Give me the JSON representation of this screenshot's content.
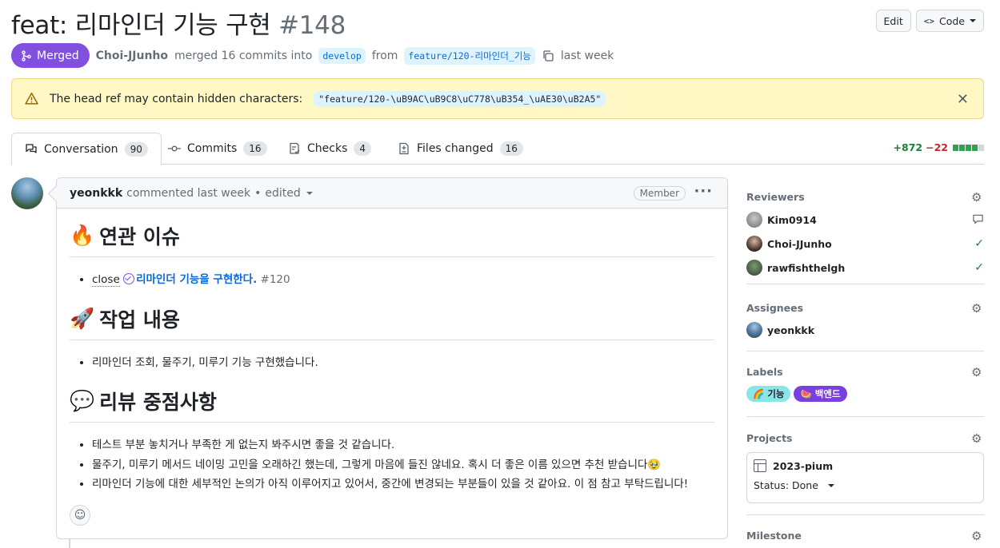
{
  "pr": {
    "title": "feat: 리마인더 기능 구현",
    "number": "#148",
    "edit_label": "Edit",
    "code_label": "Code",
    "state": "Merged",
    "author": "Choi-JJunho",
    "merge_text": "merged 16 commits into",
    "base_branch": "develop",
    "from_text": "from",
    "head_branch": "feature/120-리마인더_기능",
    "time": "last week"
  },
  "warning": {
    "text": "The head ref may contain hidden characters:",
    "code": "\"feature/120-\\uB9AC\\uB9C8\\uC778\\uB354_\\uAE30\\uB2A5\""
  },
  "tabs": [
    {
      "label": "Conversation",
      "count": "90",
      "icon": "comment-discussion-icon"
    },
    {
      "label": "Commits",
      "count": "16",
      "icon": "git-commit-icon"
    },
    {
      "label": "Checks",
      "count": "4",
      "icon": "checklist-icon"
    },
    {
      "label": "Files changed",
      "count": "16",
      "icon": "file-diff-icon"
    }
  ],
  "diffstat": {
    "additions": "+872",
    "deletions": "−22",
    "add_blocks": 4,
    "total_blocks": 5
  },
  "comment": {
    "author": "yeonkkk",
    "action": "commented last week",
    "separator": "•",
    "edited": "edited",
    "role": "Member",
    "h1_emoji": "🔥",
    "h1": "연관 이슈",
    "issue_prefix": "close",
    "issue_title": "리마인더 기능을 구현한다.",
    "issue_number": "#120",
    "h2_emoji": "🚀",
    "h2": "작업 내용",
    "work_items": [
      "리마인더 조회, 물주기, 미루기 기능 구현했습니다."
    ],
    "h3_emoji": "💬",
    "h3": "리뷰 중점사항",
    "review_items": [
      "테스트 부분 놓치거나 부족한 게 없는지 봐주시면 좋을 것 같습니다.",
      "물주기, 미루기 메서드 네이밍 고민을 오래하긴 했는데, 그렇게 마음에 들진 않네요. 혹시 더 좋은 이름 있으면 추천 받습니다🥹",
      "리마인더 기능에 대한 세부적인 논의가 아직 이루어지고 있어서, 중간에 변경되는 부분들이 있을 것 같아요. 이 점 참고 부탁드립니다!"
    ]
  },
  "sidebar": {
    "reviewers_title": "Reviewers",
    "reviewers": [
      {
        "name": "Kim0914",
        "status": "commented"
      },
      {
        "name": "Choi-JJunho",
        "status": "approved"
      },
      {
        "name": "rawfishthelgh",
        "status": "approved"
      }
    ],
    "assignees_title": "Assignees",
    "assignees": [
      "yeonkkk"
    ],
    "labels_title": "Labels",
    "labels": [
      {
        "text": "🌈 기능",
        "bg": "#8ae6e6",
        "fg": "#1f2328"
      },
      {
        "text": "🍉 백엔드",
        "bg": "#7a3fe0",
        "fg": "#ffffff"
      }
    ],
    "projects_title": "Projects",
    "project_name": "2023-pium",
    "project_status": "Status: Done",
    "milestone_title": "Milestone"
  }
}
